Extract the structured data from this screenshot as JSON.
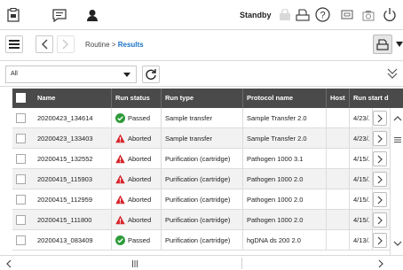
{
  "toolbar": {
    "standby_label": "Standby"
  },
  "navigation": {
    "breadcrumb_root": "Routine",
    "breadcrumb_sep": ">",
    "breadcrumb_current": "Results"
  },
  "filter": {
    "selected": "All"
  },
  "table": {
    "columns": [
      "Name",
      "Run status",
      "Run type",
      "Protocol name",
      "Host",
      "Run start d"
    ],
    "rows": [
      {
        "name": "20200423_134614",
        "status": "Passed",
        "status_kind": "passed",
        "run_type": "Sample transfer",
        "protocol": "Sample Transfer 2.0",
        "host": "",
        "start": "4/23/."
      },
      {
        "name": "20200423_133403",
        "status": "Aborted",
        "status_kind": "aborted",
        "run_type": "Sample transfer",
        "protocol": "Sample Transfer 2.0",
        "host": "",
        "start": "4/23/."
      },
      {
        "name": "20200415_132552",
        "status": "Aborted",
        "status_kind": "aborted",
        "run_type": "Purification (cartridge)",
        "protocol": "Pathogen 1000 3.1",
        "host": "",
        "start": "4/15/."
      },
      {
        "name": "20200415_115903",
        "status": "Aborted",
        "status_kind": "aborted",
        "run_type": "Purification (cartridge)",
        "protocol": "Pathogen 1000 2.0",
        "host": "",
        "start": "4/15/."
      },
      {
        "name": "20200415_112959",
        "status": "Aborted",
        "status_kind": "aborted",
        "run_type": "Purification (cartridge)",
        "protocol": "Pathogen 1000 2.0",
        "host": "",
        "start": "4/15/."
      },
      {
        "name": "20200415_111800",
        "status": "Aborted",
        "status_kind": "aborted",
        "run_type": "Purification (cartridge)",
        "protocol": "Pathogen 1000 2.0",
        "host": "",
        "start": "4/15/."
      },
      {
        "name": "20200413_083409",
        "status": "Passed",
        "status_kind": "passed",
        "run_type": "Purification (cartridge)",
        "protocol": "hgDNA ds 200 2.0",
        "host": "",
        "start": "4/13/."
      }
    ]
  },
  "colors": {
    "passed": "#2e9b3a",
    "aborted": "#d6232a",
    "header_bg": "#4a4a4a",
    "link": "#1a73c8"
  },
  "icons": [
    "clipboard-icon",
    "chat-icon",
    "user-icon",
    "lock-icon",
    "printer-icon",
    "help-icon",
    "monitor-icon",
    "camera-icon",
    "power-icon",
    "menu-icon",
    "back-icon",
    "forward-icon",
    "print-icon",
    "refresh-icon",
    "expand-icon"
  ]
}
